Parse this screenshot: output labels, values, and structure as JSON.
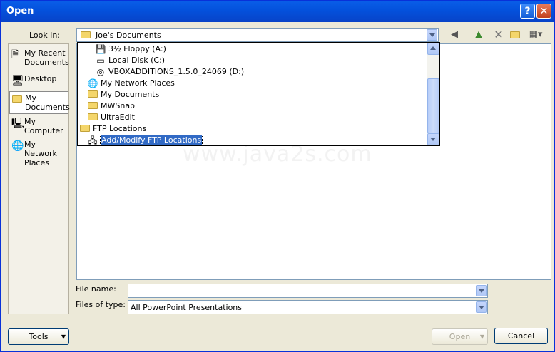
{
  "window": {
    "title": "Open"
  },
  "look_in": {
    "label": "Look in:",
    "value": "Joe's Documents"
  },
  "places": [
    {
      "label": "My Recent Documents",
      "icon": "recent-documents-icon"
    },
    {
      "label": "Desktop",
      "icon": "desktop-icon"
    },
    {
      "label": "My Documents",
      "icon": "my-documents-icon"
    },
    {
      "label": "My Computer",
      "icon": "my-computer-icon"
    },
    {
      "label": "My Network Places",
      "icon": "network-places-icon"
    }
  ],
  "dropdown_items": [
    {
      "label": "3½ Floppy (A:)",
      "icon": "floppy-icon"
    },
    {
      "label": "Local Disk (C:)",
      "icon": "disk-icon"
    },
    {
      "label": "VBOXADDITIONS_1.5.0_24069 (D:)",
      "icon": "cdrom-icon"
    },
    {
      "label": "My Network Places",
      "icon": "network-places-icon"
    },
    {
      "label": "My Documents",
      "icon": "my-documents-icon"
    },
    {
      "label": "MWSnap",
      "icon": "folder-icon"
    },
    {
      "label": "UltraEdit",
      "icon": "folder-icon"
    },
    {
      "label": "FTP Locations",
      "icon": "folder-icon"
    },
    {
      "label": "Add/Modify FTP Locations",
      "icon": "ftp-icon"
    }
  ],
  "file_name": {
    "label": "File name:",
    "value": ""
  },
  "files_of_type": {
    "label": "Files of type:",
    "value": "All PowerPoint Presentations"
  },
  "buttons": {
    "tools": "Tools",
    "open": "Open",
    "cancel": "Cancel"
  },
  "watermark": "www.java2s.com"
}
